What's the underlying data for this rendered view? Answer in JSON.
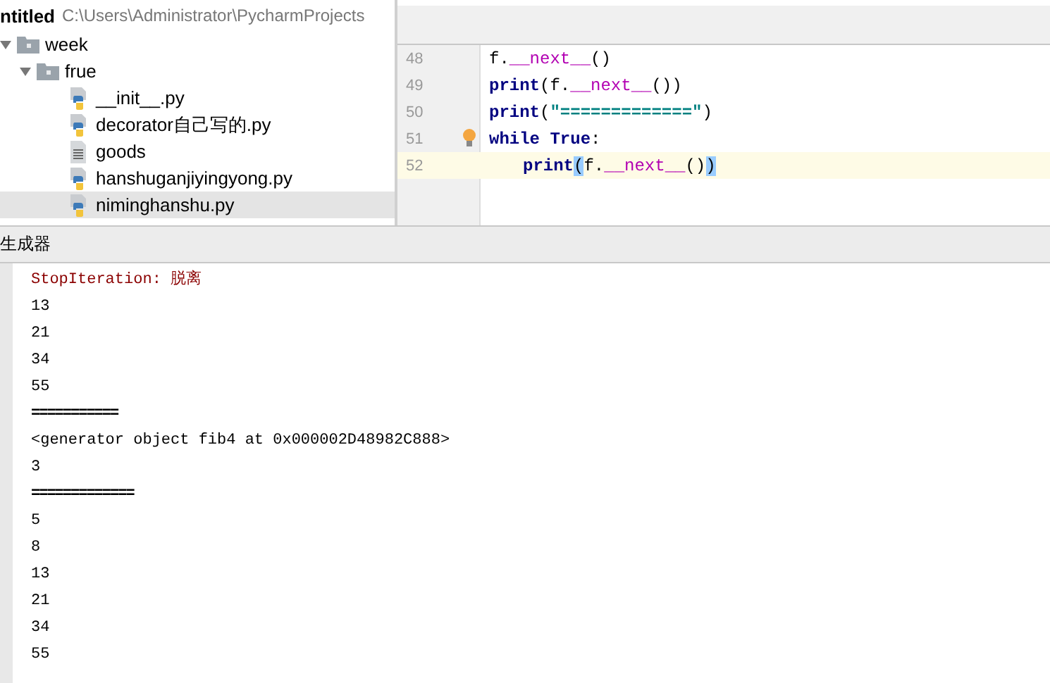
{
  "project": {
    "name": "ntitled",
    "path": "C:\\Users\\Administrator\\PycharmProjects"
  },
  "tree": [
    {
      "label": "week",
      "kind": "folder",
      "expanded": true,
      "selected": false,
      "children": [
        {
          "label": "frue",
          "kind": "folder",
          "expanded": true,
          "selected": false,
          "children": [
            {
              "label": "__init__.py",
              "kind": "python",
              "selected": false
            },
            {
              "label": "decorator自己写的.py",
              "kind": "python",
              "selected": false
            },
            {
              "label": "goods",
              "kind": "text",
              "selected": false
            },
            {
              "label": "hanshuganjiyingyong.py",
              "kind": "python",
              "selected": false
            },
            {
              "label": "niminghanshu.py",
              "kind": "python",
              "selected": true
            }
          ]
        }
      ]
    }
  ],
  "editor": {
    "lines": [
      {
        "number": "48",
        "current": false,
        "bulb": false,
        "tokens": [
          {
            "text": "f.",
            "kind": "plain"
          },
          {
            "text": "__next__",
            "kind": "magic"
          },
          {
            "text": "()",
            "kind": "plain"
          }
        ]
      },
      {
        "number": "49",
        "current": false,
        "bulb": false,
        "tokens": [
          {
            "text": "print",
            "kind": "keyword"
          },
          {
            "text": "(f.",
            "kind": "plain"
          },
          {
            "text": "__next__",
            "kind": "magic"
          },
          {
            "text": "())",
            "kind": "plain"
          }
        ]
      },
      {
        "number": "50",
        "current": false,
        "bulb": false,
        "tokens": [
          {
            "text": "print",
            "kind": "keyword"
          },
          {
            "text": "(",
            "kind": "plain"
          },
          {
            "text": "\"=============\"",
            "kind": "string"
          },
          {
            "text": ")",
            "kind": "plain"
          }
        ]
      },
      {
        "number": "51",
        "current": false,
        "bulb": true,
        "tokens": [
          {
            "text": "while",
            "kind": "keyword"
          },
          {
            "text": " True",
            "kind": "keyword"
          },
          {
            "text": ":",
            "kind": "plain"
          }
        ]
      },
      {
        "number": "52",
        "current": true,
        "bulb": false,
        "indented": true,
        "tokens": [
          {
            "text": "print",
            "kind": "keyword"
          },
          {
            "text": "(",
            "kind": "match"
          },
          {
            "text": "f.",
            "kind": "plain"
          },
          {
            "text": "__next__",
            "kind": "magic"
          },
          {
            "text": "()",
            "kind": "plain"
          },
          {
            "text": ")",
            "kind": "match"
          }
        ]
      }
    ]
  },
  "run_panel": {
    "title": "生成器",
    "output": [
      {
        "text": "StopIteration: 脱离",
        "kind": "error"
      },
      {
        "text": "13",
        "kind": "normal"
      },
      {
        "text": "21",
        "kind": "normal"
      },
      {
        "text": "34",
        "kind": "normal"
      },
      {
        "text": "55",
        "kind": "normal"
      },
      {
        "text": "===========",
        "kind": "rule"
      },
      {
        "text": "<generator object fib4 at 0x000002D48982C888>",
        "kind": "normal"
      },
      {
        "text": "3",
        "kind": "normal"
      },
      {
        "text": "=============",
        "kind": "rule"
      },
      {
        "text": "5",
        "kind": "normal"
      },
      {
        "text": "8",
        "kind": "normal"
      },
      {
        "text": "13",
        "kind": "normal"
      },
      {
        "text": "21",
        "kind": "normal"
      },
      {
        "text": "34",
        "kind": "normal"
      },
      {
        "text": "55",
        "kind": "normal"
      }
    ]
  }
}
